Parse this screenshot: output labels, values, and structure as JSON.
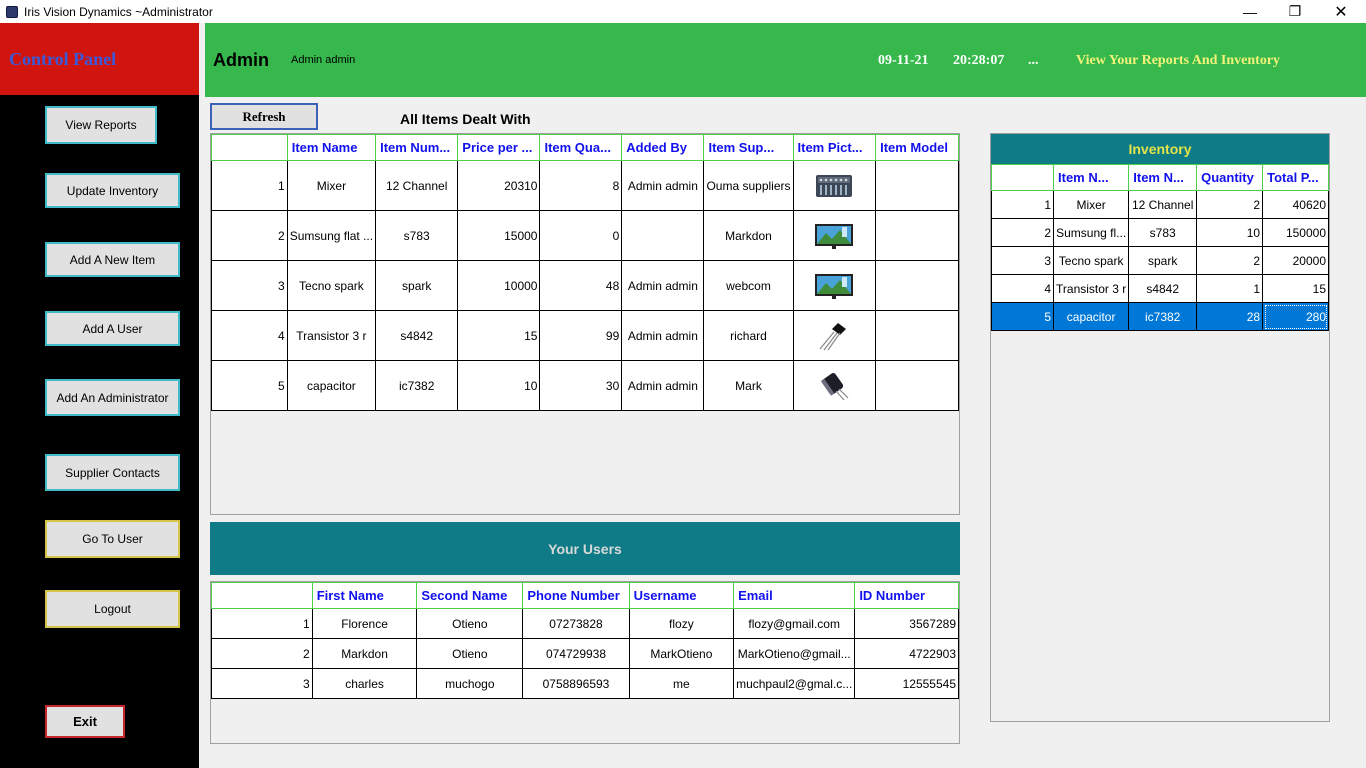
{
  "window": {
    "title": "Iris Vision Dynamics ~Administrator"
  },
  "control_panel": {
    "title": "Control Panel",
    "buttons": [
      "View Reports",
      "Update Inventory",
      "Add A New Item",
      "Add A User",
      "Add An Administrator",
      "Supplier Contacts",
      "Go To User",
      "Logout"
    ],
    "exit": "Exit"
  },
  "header": {
    "role": "Admin",
    "user": "Admin admin",
    "date": "09-11-21",
    "time": "20:28:07",
    "dots": "...",
    "tagline": "View Your Reports And Inventory"
  },
  "toolbar": {
    "refresh": "Refresh",
    "items_title": "All Items Dealt With"
  },
  "items": {
    "columns": [
      "Item Name",
      "Item Num...",
      "Price per ...",
      "Item Qua...",
      "Added By",
      "Item Sup...",
      "Item Pict...",
      "Item Model"
    ],
    "rows": [
      [
        "1",
        "Mixer",
        "12 Channel",
        "20310",
        "8",
        "Admin admin",
        "Ouma suppliers",
        "mixer-picture",
        ""
      ],
      [
        "2",
        "Sumsung flat ...",
        "s783",
        "15000",
        "0",
        "",
        "Markdon",
        "tv-picture",
        ""
      ],
      [
        "3",
        "Tecno spark",
        "spark",
        "10000",
        "48",
        "Admin admin",
        "webcom",
        "tv-picture",
        ""
      ],
      [
        "4",
        "Transistor 3 r",
        "s4842",
        "15",
        "99",
        "Admin admin",
        "richard",
        "transistor-picture",
        ""
      ],
      [
        "5",
        "capacitor",
        "ic7382",
        "10",
        "30",
        "Admin admin",
        "Mark",
        "capacitor-picture",
        ""
      ]
    ]
  },
  "users": {
    "title": "Your Users",
    "columns": [
      "First Name",
      "Second Name",
      "Phone Number",
      "Username",
      "Email",
      "ID Number"
    ],
    "rows": [
      [
        "1",
        "Florence",
        "Otieno",
        "07273828",
        "flozy",
        "flozy@gmail.com",
        "3567289"
      ],
      [
        "2",
        "Markdon",
        "Otieno",
        "074729938",
        "MarkOtieno",
        "MarkOtieno@gmail...",
        "4722903"
      ],
      [
        "3",
        "charles",
        "muchogo",
        "0758896593",
        "me",
        "muchpaul2@gmal.c...",
        "12555545"
      ]
    ]
  },
  "inventory": {
    "title": "Inventory",
    "columns": [
      "Item N...",
      "Item N...",
      "Quantity",
      "Total P..."
    ],
    "rows": [
      [
        "1",
        "Mixer",
        "12 Channel",
        "2",
        "40620"
      ],
      [
        "2",
        "Sumsung fl...",
        "s783",
        "10",
        "150000"
      ],
      [
        "3",
        "Tecno spark",
        "spark",
        "2",
        "20000"
      ],
      [
        "4",
        "Transistor 3 r",
        "s4842",
        "1",
        "15"
      ],
      [
        "5",
        "capacitor",
        "ic7382",
        "28",
        "280"
      ]
    ],
    "selected_row": 5
  },
  "colors": {
    "control_panel_header": "#d0150f",
    "header_bar": "#36b84c",
    "banner_teal": "#0e7b86",
    "grid_header_text": "#1111ee",
    "selection": "#0078d7"
  }
}
